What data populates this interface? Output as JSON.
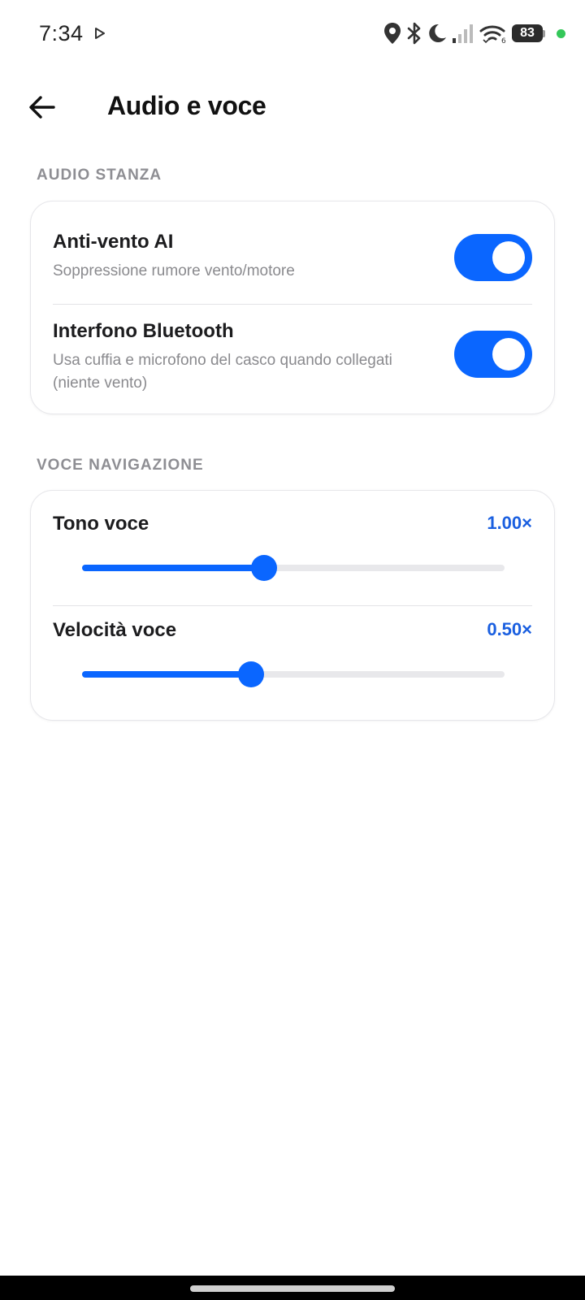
{
  "status_bar": {
    "time": "7:34",
    "battery": "83"
  },
  "header": {
    "title": "Audio e voce"
  },
  "sections": {
    "audio": {
      "label": "AUDIO STANZA",
      "rows": [
        {
          "title": "Anti-vento AI",
          "subtitle": "Soppressione rumore vento/motore",
          "enabled": true
        },
        {
          "title": "Interfono Bluetooth",
          "subtitle": "Usa cuffia e microfono del casco quando collegati (niente vento)",
          "enabled": true
        }
      ]
    },
    "voice": {
      "label": "VOCE NAVIGAZIONE",
      "rows": [
        {
          "title": "Tono voce",
          "value_text": "1.00×",
          "level": 0.43
        },
        {
          "title": "Velocità voce",
          "value_text": "0.50×",
          "level": 0.4
        }
      ]
    }
  },
  "colors": {
    "accent": "#0a66ff",
    "value_text": "#1a5fe0",
    "status_dot": "#34c759"
  }
}
